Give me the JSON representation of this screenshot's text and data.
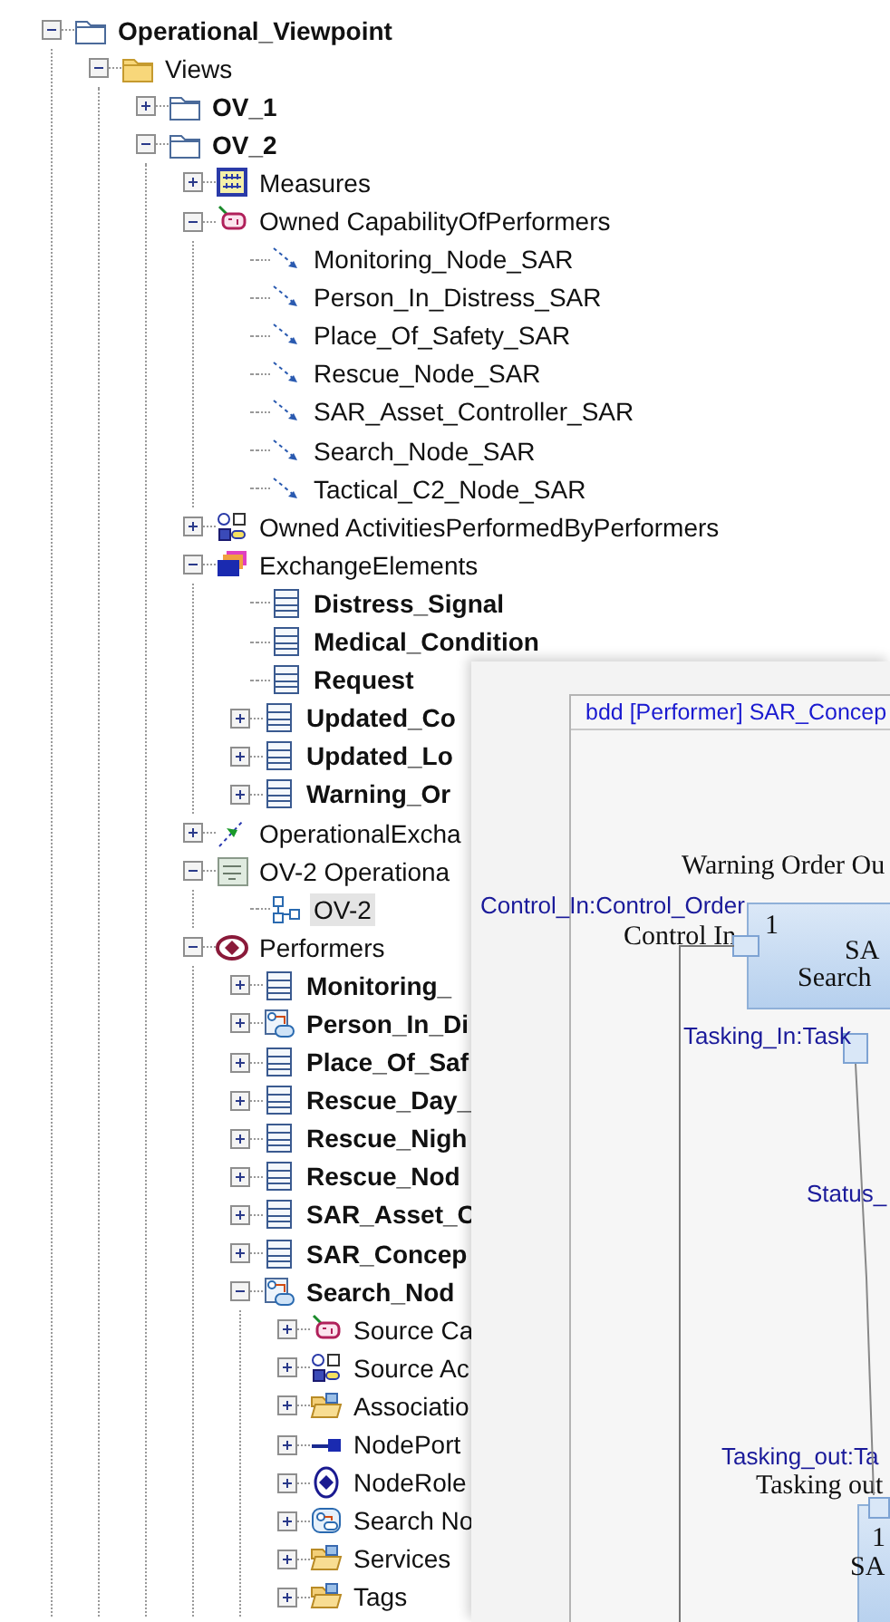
{
  "tree": [
    {
      "label": "Operational_Viewpoint",
      "kind": "folder-blue",
      "bold": true,
      "selected": false,
      "expanded": true,
      "children": [
        {
          "label": "Views",
          "kind": "folder-yellow",
          "bold": false,
          "selected": false,
          "expanded": true,
          "children": [
            {
              "label": "OV_1",
              "kind": "folder-blue",
              "bold": true,
              "selected": false,
              "expanded": false
            },
            {
              "label": "OV_2",
              "kind": "folder-blue",
              "bold": true,
              "selected": false,
              "expanded": true,
              "children": [
                {
                  "label": "Measures",
                  "kind": "measures",
                  "bold": false,
                  "selected": false,
                  "expanded": false
                },
                {
                  "label": "Owned CapabilityOfPerformers",
                  "kind": "capability",
                  "bold": false,
                  "selected": false,
                  "expanded": true,
                  "children": [
                    {
                      "label": "Monitoring_Node_SAR",
                      "kind": "dependency",
                      "bold": false,
                      "selected": false
                    },
                    {
                      "label": "Person_In_Distress_SAR",
                      "kind": "dependency",
                      "bold": false,
                      "selected": false
                    },
                    {
                      "label": "Place_Of_Safety_SAR",
                      "kind": "dependency",
                      "bold": false,
                      "selected": false
                    },
                    {
                      "label": "Rescue_Node_SAR",
                      "kind": "dependency",
                      "bold": false,
                      "selected": false
                    },
                    {
                      "label": "SAR_Asset_Controller_SAR",
                      "kind": "dependency",
                      "bold": false,
                      "selected": false
                    },
                    {
                      "label": "Search_Node_SAR",
                      "kind": "dependency",
                      "bold": false,
                      "selected": false
                    },
                    {
                      "label": "Tactical_C2_Node_SAR",
                      "kind": "dependency",
                      "bold": false,
                      "selected": false
                    }
                  ]
                },
                {
                  "label": "Owned ActivitiesPerformedByPerformers",
                  "kind": "activities",
                  "bold": false,
                  "selected": false,
                  "expanded": false
                },
                {
                  "label": "ExchangeElements",
                  "kind": "exchange",
                  "bold": false,
                  "selected": false,
                  "expanded": true,
                  "children": [
                    {
                      "label": "Distress_Signal",
                      "kind": "class",
                      "bold": true,
                      "selected": false
                    },
                    {
                      "label": "Medical_Condition",
                      "kind": "class",
                      "bold": true,
                      "selected": false
                    },
                    {
                      "label": "Request",
                      "kind": "class",
                      "bold": true,
                      "selected": false
                    },
                    {
                      "label": "Updated_Co",
                      "kind": "class",
                      "bold": true,
                      "selected": false,
                      "expanded": false
                    },
                    {
                      "label": "Updated_Lo",
                      "kind": "class",
                      "bold": true,
                      "selected": false,
                      "expanded": false
                    },
                    {
                      "label": "Warning_Or",
                      "kind": "class",
                      "bold": true,
                      "selected": false,
                      "expanded": false
                    }
                  ]
                },
                {
                  "label": "OperationalExcha",
                  "kind": "flow",
                  "bold": false,
                  "selected": false,
                  "expanded": false
                },
                {
                  "label": "OV-2 Operationa",
                  "kind": "ov2",
                  "bold": false,
                  "selected": false,
                  "expanded": true,
                  "children": [
                    {
                      "label": "OV-2",
                      "kind": "diagram",
                      "bold": false,
                      "selected": true
                    }
                  ]
                },
                {
                  "label": "Performers",
                  "kind": "performers",
                  "bold": false,
                  "selected": false,
                  "expanded": true,
                  "children": [
                    {
                      "label": "Monitoring_",
                      "kind": "class",
                      "bold": true,
                      "selected": false,
                      "expanded": false
                    },
                    {
                      "label": "Person_In_Di",
                      "kind": "node",
                      "bold": true,
                      "selected": false,
                      "expanded": false
                    },
                    {
                      "label": "Place_Of_Saf",
                      "kind": "class",
                      "bold": true,
                      "selected": false,
                      "expanded": false
                    },
                    {
                      "label": "Rescue_Day_",
                      "kind": "class",
                      "bold": true,
                      "selected": false,
                      "expanded": false
                    },
                    {
                      "label": "Rescue_Nigh",
                      "kind": "class",
                      "bold": true,
                      "selected": false,
                      "expanded": false
                    },
                    {
                      "label": "Rescue_Nod",
                      "kind": "class",
                      "bold": true,
                      "selected": false,
                      "expanded": false
                    },
                    {
                      "label": "SAR_Asset_C",
                      "kind": "class",
                      "bold": true,
                      "selected": false,
                      "expanded": false
                    },
                    {
                      "label": "SAR_Concep",
                      "kind": "class",
                      "bold": true,
                      "selected": false,
                      "expanded": false
                    },
                    {
                      "label": "Search_Nod",
                      "kind": "node",
                      "bold": true,
                      "selected": false,
                      "expanded": true,
                      "children": [
                        {
                          "label": "Source Ca",
                          "kind": "capability",
                          "bold": false,
                          "selected": false,
                          "expanded": false
                        },
                        {
                          "label": "Source Ac",
                          "kind": "activities",
                          "bold": false,
                          "selected": false,
                          "expanded": false
                        },
                        {
                          "label": "Associatio",
                          "kind": "open-folder",
                          "bold": false,
                          "selected": false,
                          "expanded": false
                        },
                        {
                          "label": "NodePort",
                          "kind": "port",
                          "bold": false,
                          "selected": false,
                          "expanded": false
                        },
                        {
                          "label": "NodeRole",
                          "kind": "role",
                          "bold": false,
                          "selected": false,
                          "expanded": false
                        },
                        {
                          "label": "Search No",
                          "kind": "node-round",
                          "bold": false,
                          "selected": false,
                          "expanded": false
                        },
                        {
                          "label": "Services",
                          "kind": "open-folder",
                          "bold": false,
                          "selected": false,
                          "expanded": false
                        },
                        {
                          "label": "Tags",
                          "kind": "open-folder",
                          "bold": false,
                          "selected": false,
                          "expanded": false
                        }
                      ]
                    }
                  ]
                }
              ]
            }
          ]
        }
      ]
    }
  ],
  "diagram": {
    "title": "bdd [Performer] SAR_Concep",
    "warning_port": {
      "name": "Warning Order Ou"
    },
    "control_port": {
      "role": "Control_In:Control_Order",
      "name": "Control In",
      "multiplicity": "1"
    },
    "top_block": {
      "lines": [
        "SA",
        "Search"
      ]
    },
    "tasking_in_port": {
      "role": "Tasking_In:Task"
    },
    "status_label": "Status_",
    "tasking_out_port": {
      "role": "Tasking_out:Ta",
      "name": "Tasking out"
    },
    "bottom_block": {
      "multiplicity": "1",
      "name": "SA"
    }
  }
}
